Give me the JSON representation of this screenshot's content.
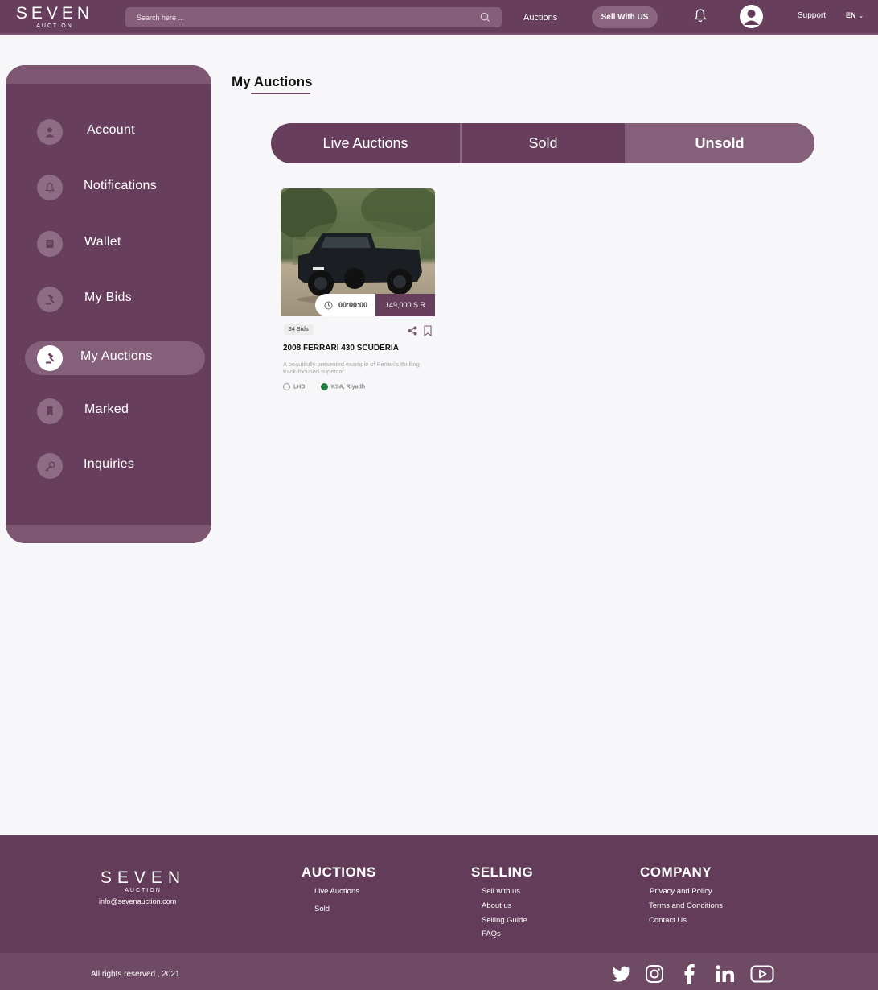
{
  "brand": {
    "name": "SEVEN",
    "sub": "AUCTION"
  },
  "header": {
    "search_placeholder": "Search here ...",
    "nav_auctions": "Auctions",
    "sell_button": "Sell With US",
    "support": "Support",
    "language": "EN"
  },
  "sidebar": {
    "items": [
      {
        "label": "Account",
        "icon": "user-icon"
      },
      {
        "label": "Notifications",
        "icon": "bell-icon"
      },
      {
        "label": "Wallet",
        "icon": "wallet-icon"
      },
      {
        "label": "My Bids",
        "icon": "gavel-icon"
      },
      {
        "label": "My Auctions",
        "icon": "gavel-icon",
        "active": true
      },
      {
        "label": "Marked",
        "icon": "bookmark-icon"
      },
      {
        "label": "Inquiries",
        "icon": "key-icon"
      }
    ]
  },
  "main": {
    "title": "My Auctions",
    "tabs": [
      {
        "label": "Live Auctions"
      },
      {
        "label": "Sold"
      },
      {
        "label": "Unsold",
        "active": true
      }
    ]
  },
  "card": {
    "timer": "00:00:00",
    "price": "149,000 S.R",
    "bids": "34 Bids",
    "title": "2008 FERRARI 430 SCUDERIA",
    "description": "A beautifully presented example of Ferrari's thrilling track-focused supercar.",
    "steering": "LHD",
    "location": "KSA, Riyadh"
  },
  "footer": {
    "email": "info@sevenauction.com",
    "auctions": {
      "heading": "AUCTIONS",
      "links": [
        "Live Auctions",
        "Sold"
      ]
    },
    "selling": {
      "heading": "SELLING",
      "links": [
        "Sell with us",
        "About us",
        "Selling Guide",
        "FAQs"
      ]
    },
    "company": {
      "heading": "COMPANY",
      "links": [
        "Privacy and Policy",
        "Terms and Conditions",
        "Contact Us"
      ]
    },
    "copyright": "All  rights reserved , 2021",
    "social": [
      "twitter-icon",
      "instagram-icon",
      "facebook-icon",
      "linkedin-icon",
      "youtube-icon"
    ]
  },
  "colors": {
    "primary": "#673f5c",
    "accent": "#85607a",
    "background": "#f7f7f9"
  }
}
